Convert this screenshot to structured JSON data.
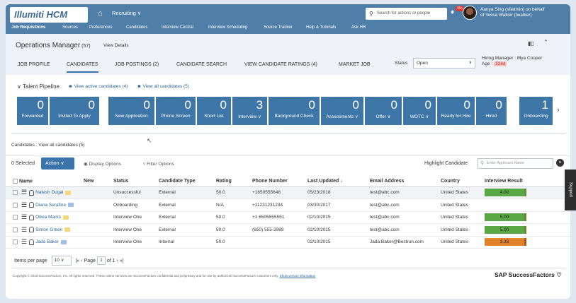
{
  "topbar": {
    "logo": "Illumiti HCM",
    "module": "Recruiting ∨",
    "search_placeholder": "Search for actions or people",
    "notification_count": "99+",
    "user_line1": "Aanya Sing (sfadmin) on behalf",
    "user_line2": "of Tessa Walker (twalker)",
    "nav": [
      "Job Requisitions",
      "Sources",
      "Preferences",
      "Candidates",
      "Interview Central",
      "Interview Scheduling",
      "Source Tracker",
      "Help & Tutorials",
      "Ask HR"
    ]
  },
  "header": {
    "title": "Operations Manager",
    "count": "(57)",
    "view_details": "View Details",
    "tabs": [
      "JOB PROFILE",
      "CANDIDATES",
      "JOB POSTINGS (2)",
      "CANDIDATE SEARCH",
      "VIEW CANDIDATE RATINGS (4)",
      "MARKET JOB"
    ],
    "status_label": "Status",
    "status_value": "Open",
    "hiring_manager": "Hiring Manager : Mya Cooper",
    "age_label": "Age :",
    "age_value": "324d"
  },
  "pipeline": {
    "title": "Talent Pipeline",
    "active_link": "View active candidates (4)",
    "all_link": "View all candidates (5)",
    "stages": [
      {
        "count": "0",
        "label": "Forwarded"
      },
      {
        "count": "0",
        "label": "Invited To Apply"
      },
      {
        "count": "0",
        "label": "New Application"
      },
      {
        "count": "0",
        "label": "Phone Screen"
      },
      {
        "count": "0",
        "label": "Short List"
      },
      {
        "count": "3",
        "label": "Interview ∨"
      },
      {
        "count": "0",
        "label": "Background Check"
      },
      {
        "count": "0",
        "label": "Assessments ∨"
      },
      {
        "count": "0",
        "label": "Offer ∨"
      },
      {
        "count": "0",
        "label": "WOTC ∨"
      },
      {
        "count": "0",
        "label": "Ready for Hire"
      },
      {
        "count": "0",
        "label": "Hired"
      },
      {
        "count": "1",
        "label": "Onboarding"
      }
    ]
  },
  "candidates": {
    "crumb": "Candidates : View all candidates (5)",
    "selected": "0 Selected",
    "action": "Action",
    "display_options": "Display Options",
    "filter_options": "Filter Options",
    "highlight_label": "Highlight Candidate",
    "highlight_placeholder": "Enter Applicant Name",
    "columns": [
      "Name",
      "New",
      "Status",
      "Candidate Type",
      "Rating",
      "Phone Number",
      "Last Updated ↓",
      "Email Address",
      "Country",
      "Interview Result"
    ],
    "rows": [
      {
        "name": "Natesh Dugal",
        "new": "",
        "status": "Unsuccessful",
        "type": "External",
        "rating": "50.0",
        "phone": "+1650555648",
        "updated": "05/23/2018",
        "email": "test@abc.com",
        "country": "United States",
        "result": "4.00",
        "result_color": "green"
      },
      {
        "name": "Diana Serafine",
        "new": "",
        "status": "Onboarding",
        "type": "External",
        "rating": "N/A",
        "phone": "+11231231234",
        "updated": "03/30/2017",
        "email": "test@abc.com",
        "country": "United States",
        "result": "",
        "result_color": ""
      },
      {
        "name": "Olivia Marks",
        "new": "",
        "status": "Interview One",
        "type": "External",
        "rating": "50.0",
        "phone": "+1 6505555551",
        "updated": "02/10/2015",
        "email": "test@abc.com",
        "country": "United States",
        "result": "5.00",
        "result_color": "green"
      },
      {
        "name": "Simon Green",
        "new": "",
        "status": "Interview One",
        "type": "External",
        "rating": "50.0",
        "phone": "(650) 555-3989",
        "updated": "02/10/2015",
        "email": "test@abc.com",
        "country": "United States",
        "result": "5.00",
        "result_color": "green"
      },
      {
        "name": "Jada Baker",
        "new": "",
        "status": "Interview One",
        "type": "Internal",
        "rating": "50.0",
        "phone": "",
        "updated": "02/10/2015",
        "email": "Jada.Baker@Bestrun.com",
        "country": "United States",
        "result": "3.33",
        "result_color": "orange"
      }
    ]
  },
  "pager": {
    "items_label": "Items per page",
    "items_value": "10",
    "page_label": "Page",
    "page_value": "1",
    "of_label": "of 1"
  },
  "footer": {
    "copyright": "Copyright © 2018 SuccessFactors, Inc. All rights reserved. These online services are SuccessFactors confidential and proprietary and for use by authorized SuccessFactors customers only.",
    "privacy": "Show version information",
    "brand": "SAP SuccessFactors"
  },
  "support": "Support",
  "colors": {
    "topbar": "#4f7fa8",
    "tile": "#3e76a7",
    "action": "#3a74ab",
    "result_green": "#5aa845",
    "result_orange": "#e0832c"
  }
}
